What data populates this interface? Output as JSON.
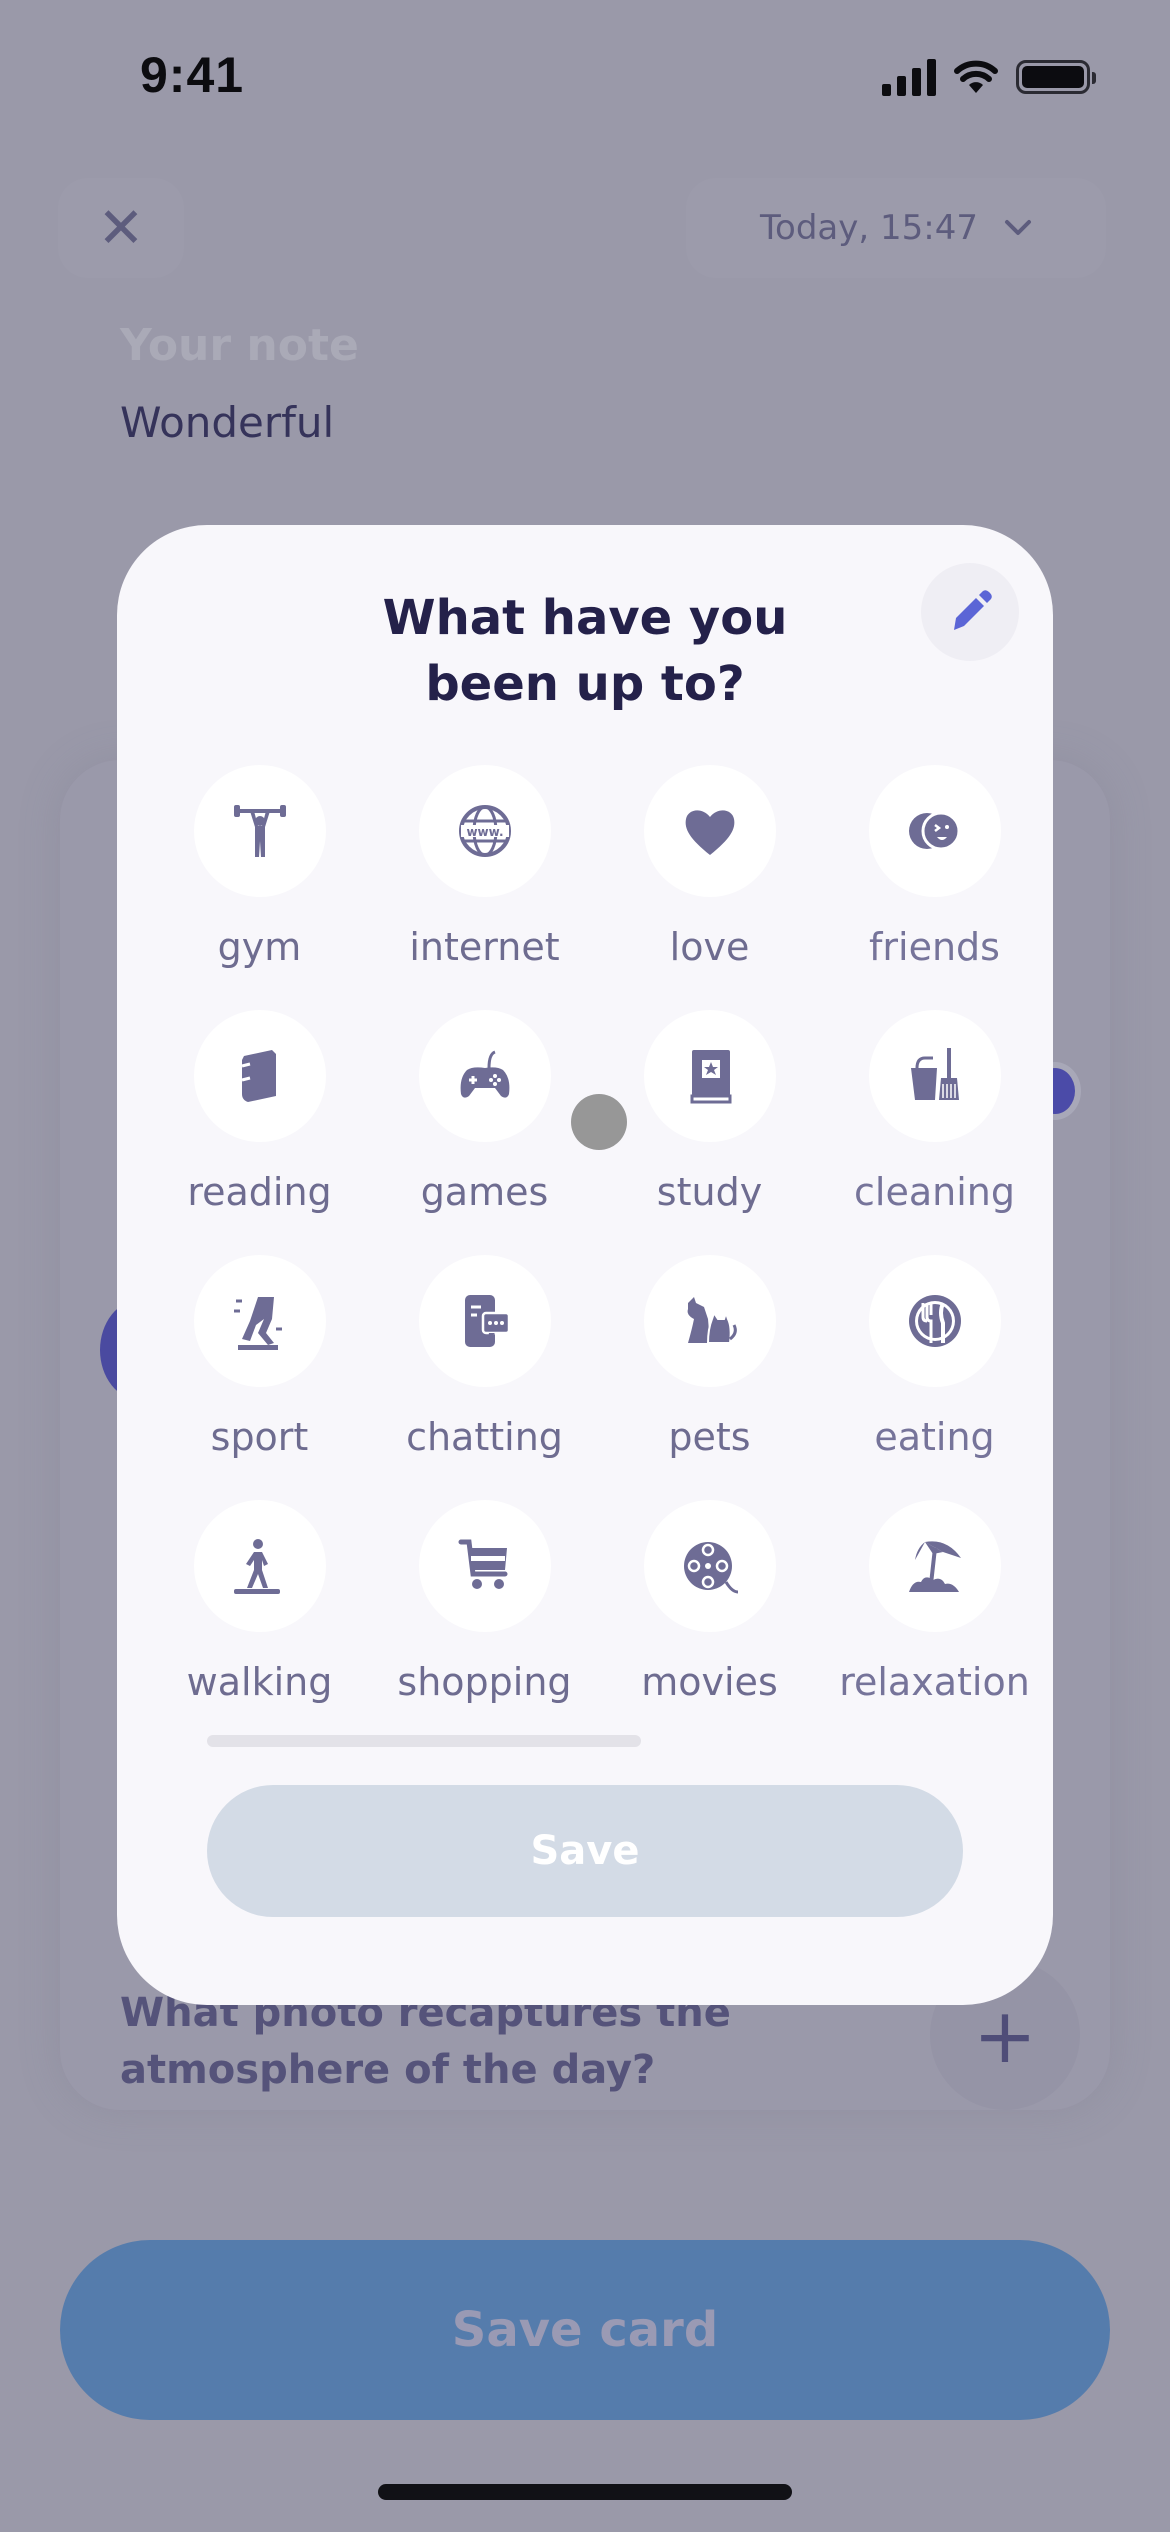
{
  "status_bar": {
    "time": "9:41",
    "icons": [
      "cellular-signal-icon",
      "wifi-icon",
      "battery-icon"
    ]
  },
  "background": {
    "close_icon": "close-icon",
    "close_glyph": "✕",
    "date_label": "Today, 15:47",
    "date_chevron": "⌄",
    "note_label": "Your note",
    "note_value": "Wonderful",
    "photo_question": "What photo recaptures the atmosphere of the day?",
    "add_photo_glyph": "+",
    "save_card_label": "Save card",
    "save_card_color": "#557cac"
  },
  "modal": {
    "title_line1": "What have you",
    "title_line2": "been up to?",
    "edit_icon": "pencil-icon",
    "edit_icon_color": "#5b65d6",
    "icon_color": "#6e6c95",
    "activities": [
      {
        "label": "gym",
        "icon": "weightlifter-icon"
      },
      {
        "label": "internet",
        "icon": "globe-www-icon"
      },
      {
        "label": "love",
        "icon": "heart-icon"
      },
      {
        "label": "friends",
        "icon": "friends-faces-icon"
      },
      {
        "label": "reading",
        "icon": "book-icon"
      },
      {
        "label": "games",
        "icon": "gamepad-icon"
      },
      {
        "label": "study",
        "icon": "star-book-icon"
      },
      {
        "label": "cleaning",
        "icon": "bucket-broom-icon"
      },
      {
        "label": "sport",
        "icon": "running-legs-icon"
      },
      {
        "label": "chatting",
        "icon": "phone-chat-icon"
      },
      {
        "label": "pets",
        "icon": "dog-cat-icon"
      },
      {
        "label": "eating",
        "icon": "plate-cutlery-icon"
      },
      {
        "label": "walking",
        "icon": "walking-person-icon"
      },
      {
        "label": "shopping",
        "icon": "shopping-cart-icon"
      },
      {
        "label": "movies",
        "icon": "film-reel-icon"
      },
      {
        "label": "relaxation",
        "icon": "beach-umbrella-icon"
      }
    ],
    "save_label": "Save",
    "save_color": "#d3dbe6"
  }
}
